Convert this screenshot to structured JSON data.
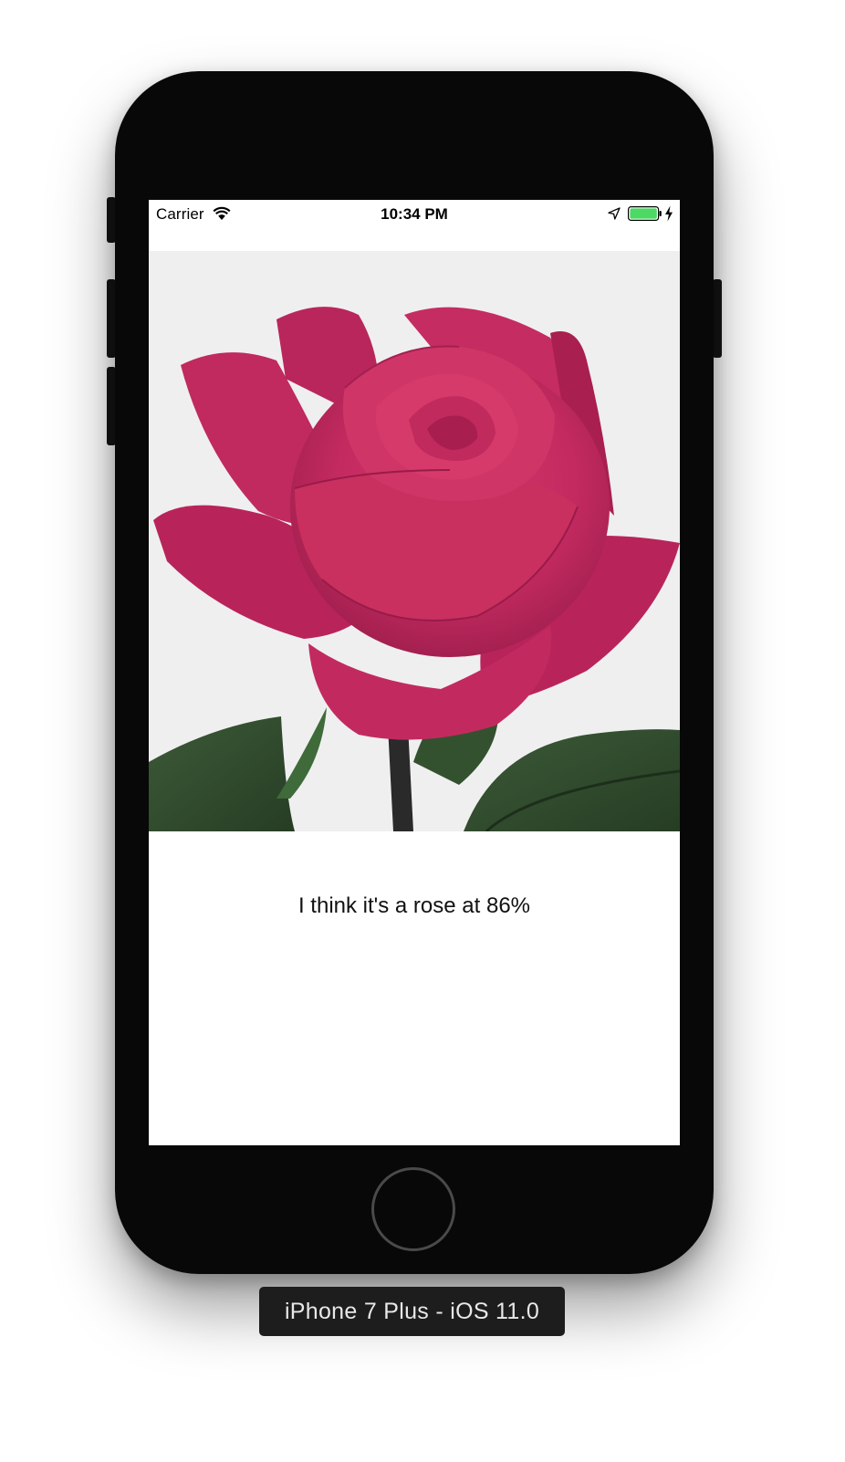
{
  "status_bar": {
    "carrier": "Carrier",
    "time": "10:34 PM",
    "icons": [
      "wifi-icon",
      "location-arrow-icon",
      "battery-icon",
      "charging-bolt-icon"
    ],
    "battery_color": "#4cd964"
  },
  "main": {
    "image_subject": "rose",
    "result_text": "I think it's a rose at 86%"
  },
  "simulator": {
    "device_label": "iPhone 7 Plus - iOS 11.0"
  },
  "colors": {
    "rose": "#c22a5f",
    "leaf": "#2f4a2c",
    "photo_background": "#efeff0"
  }
}
